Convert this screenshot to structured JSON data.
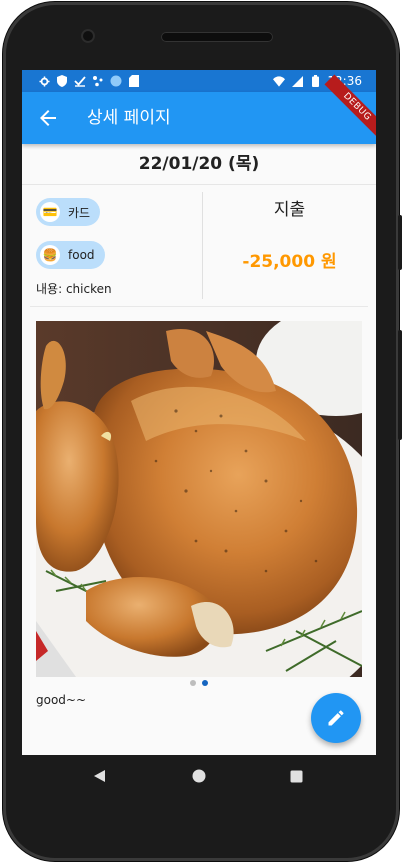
{
  "status_bar": {
    "time": "12:36",
    "left_icons": [
      "gear-icon",
      "shield-icon",
      "check-icon",
      "network-icon",
      "circle-icon",
      "sdcard-icon"
    ],
    "right_icons": [
      "wifi-icon",
      "signal-icon",
      "battery-icon"
    ],
    "color": "#1976d2"
  },
  "app_bar": {
    "title": "상세 페이지",
    "back_icon": "arrow-back-icon",
    "color": "#2196f3",
    "debug_banner": "DEBUG"
  },
  "detail": {
    "date": "22/01/20 (목)",
    "payment_chip": {
      "emoji": "💳",
      "label": "카드"
    },
    "category_chip": {
      "emoji": "🍔",
      "label": "food"
    },
    "memo": "내용: chicken",
    "type": "지출",
    "amount": "-25,000 원",
    "amount_color": "#ff9800"
  },
  "carousel": {
    "image": "roast-chicken-photo",
    "page_count": 2,
    "current_page": 2
  },
  "note": "good~~",
  "fab": {
    "icon": "edit-pencil-icon",
    "color": "#2196f3"
  },
  "nav": {
    "buttons": [
      "back-triangle-icon",
      "home-circle-icon",
      "recents-square-icon"
    ]
  }
}
